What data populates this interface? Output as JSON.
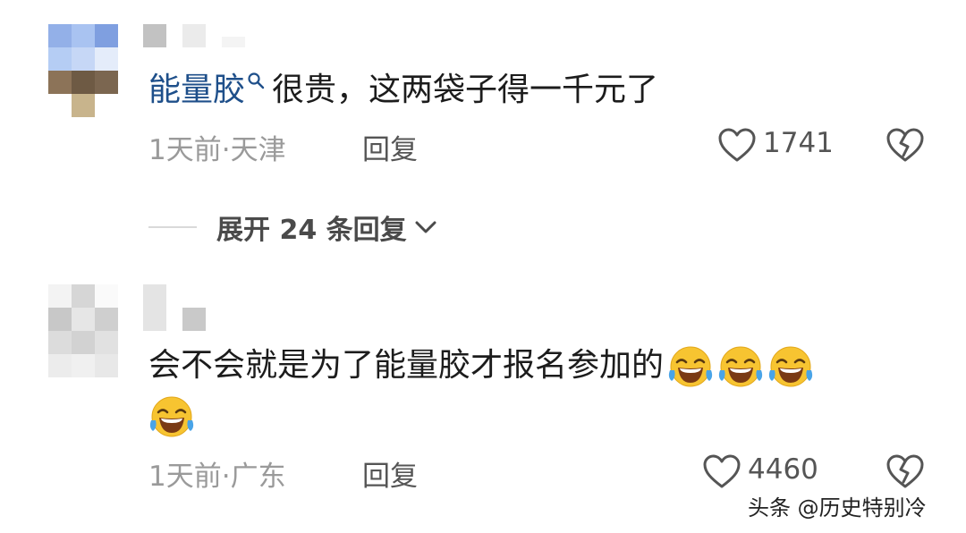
{
  "comments": [
    {
      "keyword": "能量胶",
      "text": "很贵，这两袋子得一千元了",
      "time": "1天前",
      "separator": "·",
      "location": "天津",
      "reply_label": "回复",
      "likes": "1741"
    },
    {
      "text": "会不会就是为了能量胶才报名参加的",
      "emoji_name": "laughing-crying-emoji",
      "emoji_count": 4,
      "time": "1天前",
      "separator": "·",
      "location": "广东",
      "reply_label": "回复",
      "likes": "4460"
    }
  ],
  "expand_replies": {
    "label": "展开 24 条回复",
    "icon": "chevron-down-icon"
  },
  "watermark": "头条 @历史特别冷",
  "colors": {
    "keyword": "#1e4f8a",
    "text": "#1c1c1c",
    "meta": "#9a9a9a",
    "icon": "#555555",
    "emoji_face": "#f7c431",
    "emoji_tears": "#49a4e8"
  }
}
